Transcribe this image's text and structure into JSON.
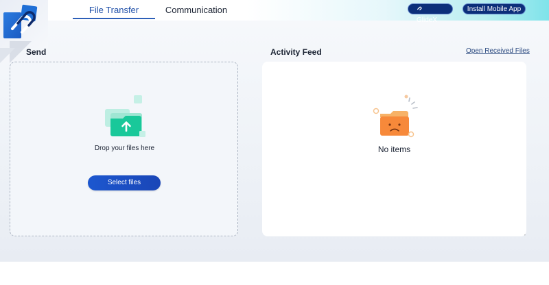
{
  "tabs": [
    {
      "label": "File Transfer",
      "active": true
    },
    {
      "label": "Communication",
      "active": false
    }
  ],
  "header": {
    "glidex_label": "GlideX",
    "install_label": "Install Mobile App"
  },
  "send": {
    "title": "Send",
    "drop_text": "Drop your files here",
    "select_button": "Select files",
    "icon": "folder-upload-icon"
  },
  "feed": {
    "title": "Activity Feed",
    "open_received_link": "Open Received Files",
    "empty_text": "No items",
    "icon": "sad-folder-icon"
  },
  "colors": {
    "accent": "#1f4fa8",
    "pill_bg": "#0c2f7a",
    "button_blue": "#1a4fc4",
    "upload_green": "#19c89a",
    "empty_orange": "#f7893a"
  }
}
